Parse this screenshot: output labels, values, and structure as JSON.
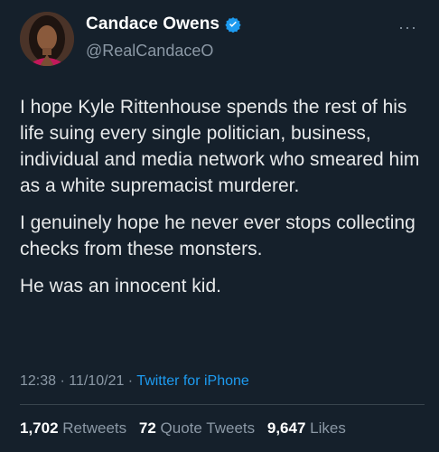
{
  "author": {
    "display_name": "Candace Owens",
    "handle": "@RealCandaceO",
    "verified": true,
    "verified_color": "#1d9bf0"
  },
  "more_icon": "···",
  "tweet": {
    "paragraphs": [
      "I hope Kyle Rittenhouse spends the rest of his life suing every single politician, business, individual and media network who smeared him as a white supremacist murderer.",
      "I genuinely hope he never ever stops collecting checks from these monsters.",
      "He was an innocent kid."
    ]
  },
  "meta": {
    "time": "12:38",
    "date": "11/10/21",
    "separator": " · ",
    "source": "Twitter for iPhone"
  },
  "stats": {
    "retweets_count": "1,702",
    "retweets_label": "Retweets",
    "quotes_count": "72",
    "quotes_label": "Quote Tweets",
    "likes_count": "9,647",
    "likes_label": "Likes"
  },
  "colors": {
    "background": "#15202b",
    "text": "#e7e9ea",
    "secondary": "#8b98a5",
    "link": "#1d9bf0"
  }
}
